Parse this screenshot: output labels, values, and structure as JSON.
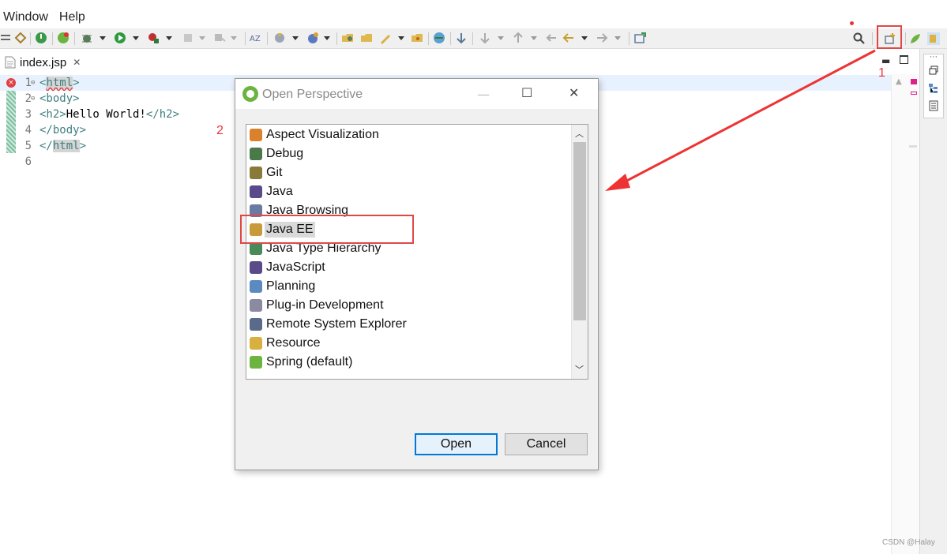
{
  "menu": {
    "items": [
      "Window",
      "Help"
    ]
  },
  "colors": {
    "annotation_red": "#e04848",
    "selection_blue": "#0078d7",
    "code_tag": "#3f7f7f"
  },
  "editor": {
    "tab_label": "index.jsp",
    "tab_close": "✕",
    "lines": [
      {
        "num": "1",
        "text_open": "<",
        "tag": "html",
        "text_close": ">"
      },
      {
        "num": "2",
        "text": "<body>"
      },
      {
        "num": "3",
        "text_a": "<h2>",
        "text_b": "Hello World!",
        "text_c": "</h2>"
      },
      {
        "num": "4",
        "text": "</body>"
      },
      {
        "num": "5",
        "text_open": "</",
        "tag": "html",
        "text_close": ">"
      },
      {
        "num": "6",
        "text": ""
      }
    ]
  },
  "annotations": {
    "step1": "1",
    "step2": "2"
  },
  "dialog": {
    "title": "Open Perspective",
    "window_minimize": "—",
    "window_maximize": "☐",
    "window_close": "✕",
    "perspectives": [
      {
        "label": "Aspect Visualization",
        "icon": "aspect-icon",
        "color": "#d9822b"
      },
      {
        "label": "Debug",
        "icon": "bug-icon",
        "color": "#4a7a4a"
      },
      {
        "label": "Git",
        "icon": "git-icon",
        "color": "#8a7a3a"
      },
      {
        "label": "Java",
        "icon": "java-icon",
        "color": "#5a4a8a"
      },
      {
        "label": "Java Browsing",
        "icon": "java-browsing-icon",
        "color": "#6a7aa0"
      },
      {
        "label": "Java EE",
        "icon": "java-ee-icon",
        "color": "#c89a3a",
        "selected": true
      },
      {
        "label": "Java Type Hierarchy",
        "icon": "type-hierarchy-icon",
        "color": "#4a8a5a"
      },
      {
        "label": "JavaScript",
        "icon": "javascript-icon",
        "color": "#5a4a8a"
      },
      {
        "label": "Planning",
        "icon": "planning-icon",
        "color": "#5a8ac0"
      },
      {
        "label": "Plug-in Development",
        "icon": "plugin-icon",
        "color": "#8a8aa0"
      },
      {
        "label": "Remote System Explorer",
        "icon": "remote-system-icon",
        "color": "#5a6a8a"
      },
      {
        "label": "Resource",
        "icon": "resource-icon",
        "color": "#d8b040"
      },
      {
        "label": "Spring (default)",
        "icon": "spring-icon",
        "color": "#6db33f"
      }
    ],
    "open_label": "Open",
    "cancel_label": "Cancel"
  },
  "watermark": "CSDN @Halay"
}
